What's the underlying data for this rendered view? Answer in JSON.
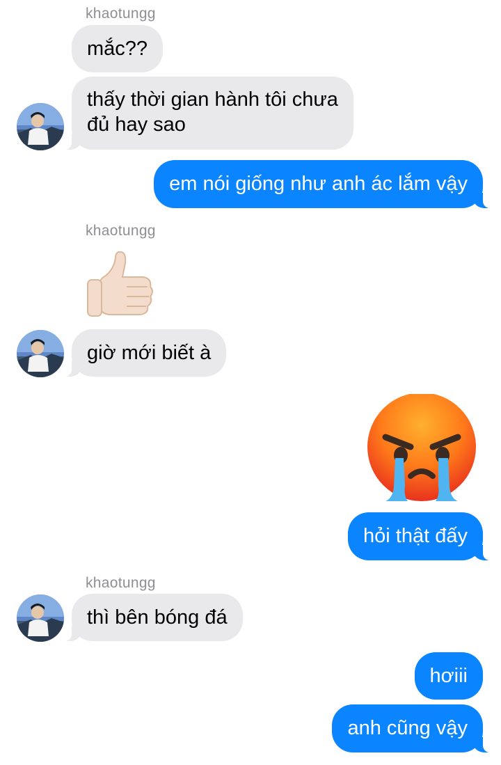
{
  "conversation": {
    "sender_name": "khaotungg",
    "messages": [
      {
        "from": "them",
        "text": "mắc??"
      },
      {
        "from": "them",
        "text": "thấy thời gian hành tôi chưa\nđủ hay sao"
      },
      {
        "from": "me",
        "text": "em nói giống như anh ác lắm vậy"
      },
      {
        "from": "them",
        "emoji": "thumbs-up"
      },
      {
        "from": "them",
        "text": "giờ mới biết à"
      },
      {
        "from": "me",
        "emoji": "angry-crying-face"
      },
      {
        "from": "me",
        "text": "hỏi thật đấy"
      },
      {
        "from": "them",
        "text": "thì bên bóng đá"
      },
      {
        "from": "me",
        "text": "hơiii"
      },
      {
        "from": "me",
        "text": "anh cũng vậy"
      }
    ]
  },
  "colors": {
    "incoming_bubble": "#e9e9eb",
    "outgoing_bubble": "#0a84ff",
    "sender_label": "#8e8e93"
  }
}
